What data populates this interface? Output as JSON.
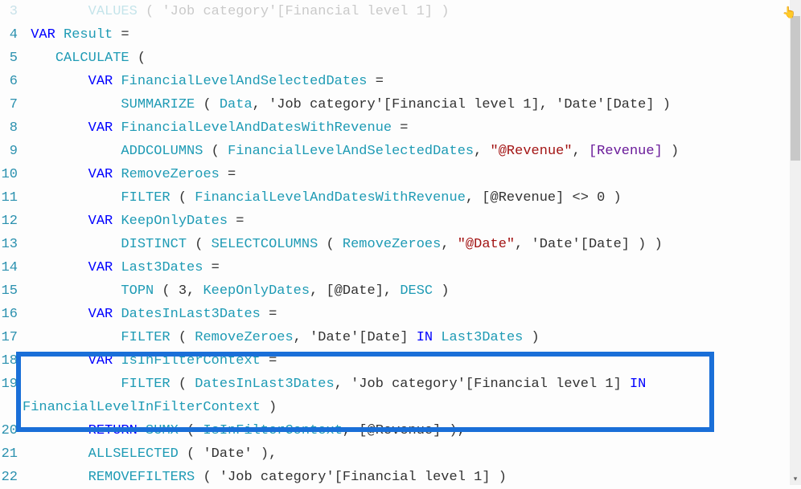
{
  "lines": [
    {
      "num": "3",
      "indent": "        ",
      "tokens": [
        [
          "fn",
          "VALUES"
        ],
        [
          "op",
          " ( "
        ],
        [
          "tbl",
          "'Job category'"
        ],
        [
          "op",
          "["
        ],
        [
          "tbl",
          "Financial level 1"
        ],
        [
          "op",
          "] )"
        ]
      ],
      "faded": true
    },
    {
      "num": "4",
      "indent": " ",
      "tokens": [
        [
          "kw",
          "VAR"
        ],
        [
          "op",
          " "
        ],
        [
          "ident",
          "Result"
        ],
        [
          "op",
          " ="
        ]
      ]
    },
    {
      "num": "5",
      "indent": "    ",
      "tokens": [
        [
          "fn",
          "CALCULATE"
        ],
        [
          "op",
          " ("
        ]
      ]
    },
    {
      "num": "6",
      "indent": "        ",
      "tokens": [
        [
          "kw",
          "VAR"
        ],
        [
          "op",
          " "
        ],
        [
          "ident",
          "FinancialLevelAndSelectedDates"
        ],
        [
          "op",
          " ="
        ]
      ]
    },
    {
      "num": "7",
      "indent": "            ",
      "tokens": [
        [
          "fn",
          "SUMMARIZE"
        ],
        [
          "op",
          " ( "
        ],
        [
          "ident",
          "Data"
        ],
        [
          "op",
          ", "
        ],
        [
          "tbl",
          "'Job category'"
        ],
        [
          "op",
          "["
        ],
        [
          "tbl",
          "Financial level 1"
        ],
        [
          "op",
          "], "
        ],
        [
          "tbl",
          "'Date'"
        ],
        [
          "op",
          "["
        ],
        [
          "tbl",
          "Date"
        ],
        [
          "op",
          "] )"
        ]
      ]
    },
    {
      "num": "8",
      "indent": "        ",
      "tokens": [
        [
          "kw",
          "VAR"
        ],
        [
          "op",
          " "
        ],
        [
          "ident",
          "FinancialLevelAndDatesWithRevenue"
        ],
        [
          "op",
          " ="
        ]
      ]
    },
    {
      "num": "9",
      "indent": "            ",
      "tokens": [
        [
          "fn",
          "ADDCOLUMNS"
        ],
        [
          "op",
          " ( "
        ],
        [
          "ident",
          "FinancialLevelAndSelectedDates"
        ],
        [
          "op",
          ", "
        ],
        [
          "str",
          "\"@Revenue\""
        ],
        [
          "op",
          ", "
        ],
        [
          "meas",
          "[Revenue]"
        ],
        [
          "op",
          " )"
        ]
      ]
    },
    {
      "num": "10",
      "indent": "        ",
      "tokens": [
        [
          "kw",
          "VAR"
        ],
        [
          "op",
          " "
        ],
        [
          "ident",
          "RemoveZeroes"
        ],
        [
          "op",
          " ="
        ]
      ]
    },
    {
      "num": "11",
      "indent": "            ",
      "tokens": [
        [
          "fn",
          "FILTER"
        ],
        [
          "op",
          " ( "
        ],
        [
          "ident",
          "FinancialLevelAndDatesWithRevenue"
        ],
        [
          "op",
          ", ["
        ],
        [
          "tbl",
          "@Revenue"
        ],
        [
          "op",
          "] <> "
        ],
        [
          "num",
          "0"
        ],
        [
          "op",
          " )"
        ]
      ]
    },
    {
      "num": "12",
      "indent": "        ",
      "tokens": [
        [
          "kw",
          "VAR"
        ],
        [
          "op",
          " "
        ],
        [
          "ident",
          "KeepOnlyDates"
        ],
        [
          "op",
          " ="
        ]
      ]
    },
    {
      "num": "13",
      "indent": "            ",
      "tokens": [
        [
          "fn",
          "DISTINCT"
        ],
        [
          "op",
          " ( "
        ],
        [
          "fn",
          "SELECTCOLUMNS"
        ],
        [
          "op",
          " ( "
        ],
        [
          "ident",
          "RemoveZeroes"
        ],
        [
          "op",
          ", "
        ],
        [
          "str",
          "\"@Date\""
        ],
        [
          "op",
          ", "
        ],
        [
          "tbl",
          "'Date'"
        ],
        [
          "op",
          "["
        ],
        [
          "tbl",
          "Date"
        ],
        [
          "op",
          "] ) )"
        ]
      ]
    },
    {
      "num": "14",
      "indent": "        ",
      "tokens": [
        [
          "kw",
          "VAR"
        ],
        [
          "op",
          " "
        ],
        [
          "ident",
          "Last3Dates"
        ],
        [
          "op",
          " ="
        ]
      ]
    },
    {
      "num": "15",
      "indent": "            ",
      "tokens": [
        [
          "fn",
          "TOPN"
        ],
        [
          "op",
          " ( "
        ],
        [
          "num",
          "3"
        ],
        [
          "op",
          ", "
        ],
        [
          "ident",
          "KeepOnlyDates"
        ],
        [
          "op",
          ", ["
        ],
        [
          "tbl",
          "@Date"
        ],
        [
          "op",
          "], "
        ],
        [
          "desc",
          "DESC"
        ],
        [
          "op",
          " )"
        ]
      ]
    },
    {
      "num": "16",
      "indent": "        ",
      "tokens": [
        [
          "kw",
          "VAR"
        ],
        [
          "op",
          " "
        ],
        [
          "ident",
          "DatesInLast3Dates"
        ],
        [
          "op",
          " ="
        ]
      ]
    },
    {
      "num": "17",
      "indent": "            ",
      "tokens": [
        [
          "fn",
          "FILTER"
        ],
        [
          "op",
          " ( "
        ],
        [
          "ident",
          "RemoveZeroes"
        ],
        [
          "op",
          ", "
        ],
        [
          "tbl",
          "'Date'"
        ],
        [
          "op",
          "["
        ],
        [
          "tbl",
          "Date"
        ],
        [
          "op",
          "] "
        ],
        [
          "kw",
          "IN"
        ],
        [
          "op",
          " "
        ],
        [
          "ident",
          "Last3Dates"
        ],
        [
          "op",
          " )"
        ]
      ]
    },
    {
      "num": "18",
      "indent": "        ",
      "tokens": [
        [
          "kw",
          "VAR"
        ],
        [
          "op",
          " "
        ],
        [
          "ident",
          "IsInFilterContext"
        ],
        [
          "op",
          " ="
        ]
      ]
    },
    {
      "num": "19",
      "indent": "            ",
      "tokens": [
        [
          "fn",
          "FILTER"
        ],
        [
          "op",
          " ( "
        ],
        [
          "ident",
          "DatesInLast3Dates"
        ],
        [
          "op",
          ", "
        ],
        [
          "tbl",
          "'Job category'"
        ],
        [
          "op",
          "["
        ],
        [
          "tbl",
          "Financial level 1"
        ],
        [
          "op",
          "] "
        ],
        [
          "kw",
          "IN"
        ]
      ]
    },
    {
      "num": "",
      "indent": "",
      "tokens": [
        [
          "ident",
          "FinancialLevelInFilterContext"
        ],
        [
          "op",
          " )"
        ]
      ]
    },
    {
      "num": "20",
      "indent": "        ",
      "tokens": [
        [
          "kw",
          "RETURN"
        ],
        [
          "op",
          " "
        ],
        [
          "fn",
          "SUMX"
        ],
        [
          "op",
          " ( "
        ],
        [
          "ident",
          "IsInFilterContext"
        ],
        [
          "op",
          ", ["
        ],
        [
          "tbl",
          "@Revenue"
        ],
        [
          "op",
          "] ),"
        ]
      ]
    },
    {
      "num": "21",
      "indent": "        ",
      "tokens": [
        [
          "fn",
          "ALLSELECTED"
        ],
        [
          "op",
          " ( "
        ],
        [
          "tbl",
          "'Date'"
        ],
        [
          "op",
          " ),"
        ]
      ]
    },
    {
      "num": "22",
      "indent": "        ",
      "tokens": [
        [
          "fn",
          "REMOVEFILTERS"
        ],
        [
          "op",
          " ( "
        ],
        [
          "tbl",
          "'Job category'"
        ],
        [
          "op",
          "["
        ],
        [
          "tbl",
          "Financial level 1"
        ],
        [
          "op",
          "] )"
        ]
      ]
    }
  ]
}
